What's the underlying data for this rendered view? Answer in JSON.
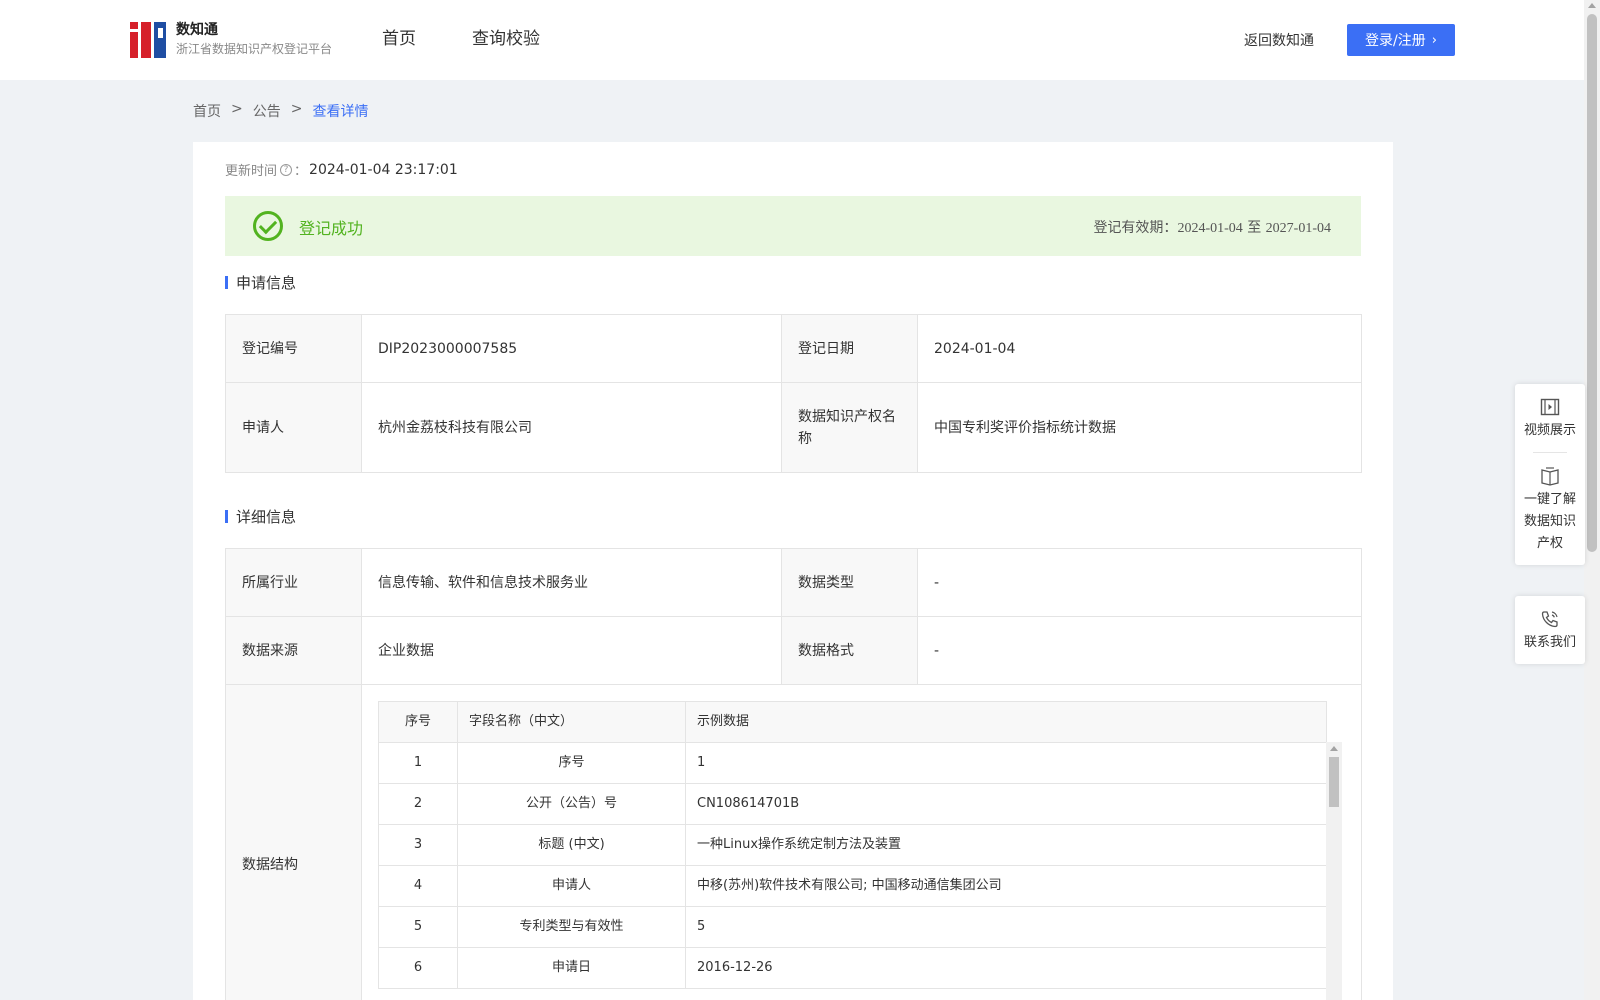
{
  "header": {
    "logo_title": "数知通",
    "logo_subtitle": "浙江省数据知识产权登记平台",
    "nav": [
      "首页",
      "查询校验"
    ],
    "return_link": "返回数知通",
    "login_label": "登录/注册"
  },
  "breadcrumb": {
    "items": [
      "首页",
      "公告"
    ],
    "separator": ">",
    "current": "查看详情"
  },
  "update": {
    "label": "更新时间",
    "colon": "：",
    "value": "2024-01-04 23:17:01"
  },
  "status": {
    "text": "登记成功",
    "validity_label": "登记有效期：",
    "validity_start": "2024-01-04",
    "validity_to": "至",
    "validity_end": "2027-01-04",
    "color": "#52b320"
  },
  "application": {
    "section_title": "申请信息",
    "reg_no_label": "登记编号",
    "reg_no": "DIP2023000007585",
    "reg_date_label": "登记日期",
    "reg_date": "2024-01-04",
    "applicant_label": "申请人",
    "applicant": "杭州金荔枝科技有限公司",
    "ip_name_label": "数据知识产权名称",
    "ip_name": "中国专利奖评价指标统计数据"
  },
  "details": {
    "section_title": "详细信息",
    "industry_label": "所属行业",
    "industry": "信息传输、软件和信息技术服务业",
    "data_type_label": "数据类型",
    "data_type": "-",
    "source_label": "数据来源",
    "source": "企业数据",
    "format_label": "数据格式",
    "format": "-",
    "structure_label": "数据结构",
    "structure": {
      "headers": [
        "序号",
        "字段名称（中文）",
        "示例数据"
      ],
      "rows": [
        [
          "1",
          "序号",
          "1"
        ],
        [
          "2",
          "公开（公告）号",
          "CN108614701B"
        ],
        [
          "3",
          "标题 (中文)",
          "一种Linux操作系统定制方法及装置"
        ],
        [
          "4",
          "申请人",
          "中移(苏州)软件技术有限公司; 中国移动通信集团公司"
        ],
        [
          "5",
          "专利类型与有效性",
          "5"
        ],
        [
          "6",
          "申请日",
          "2016-12-26"
        ]
      ]
    }
  },
  "side_panel": {
    "video": "视频展示",
    "learn": [
      "一键了解",
      "数据知识",
      "产权"
    ],
    "contact": "联系我们"
  },
  "colors": {
    "accent": "#3b6ff5",
    "success_bg": "#e9f7e0",
    "page_bg": "#eff2f5"
  }
}
